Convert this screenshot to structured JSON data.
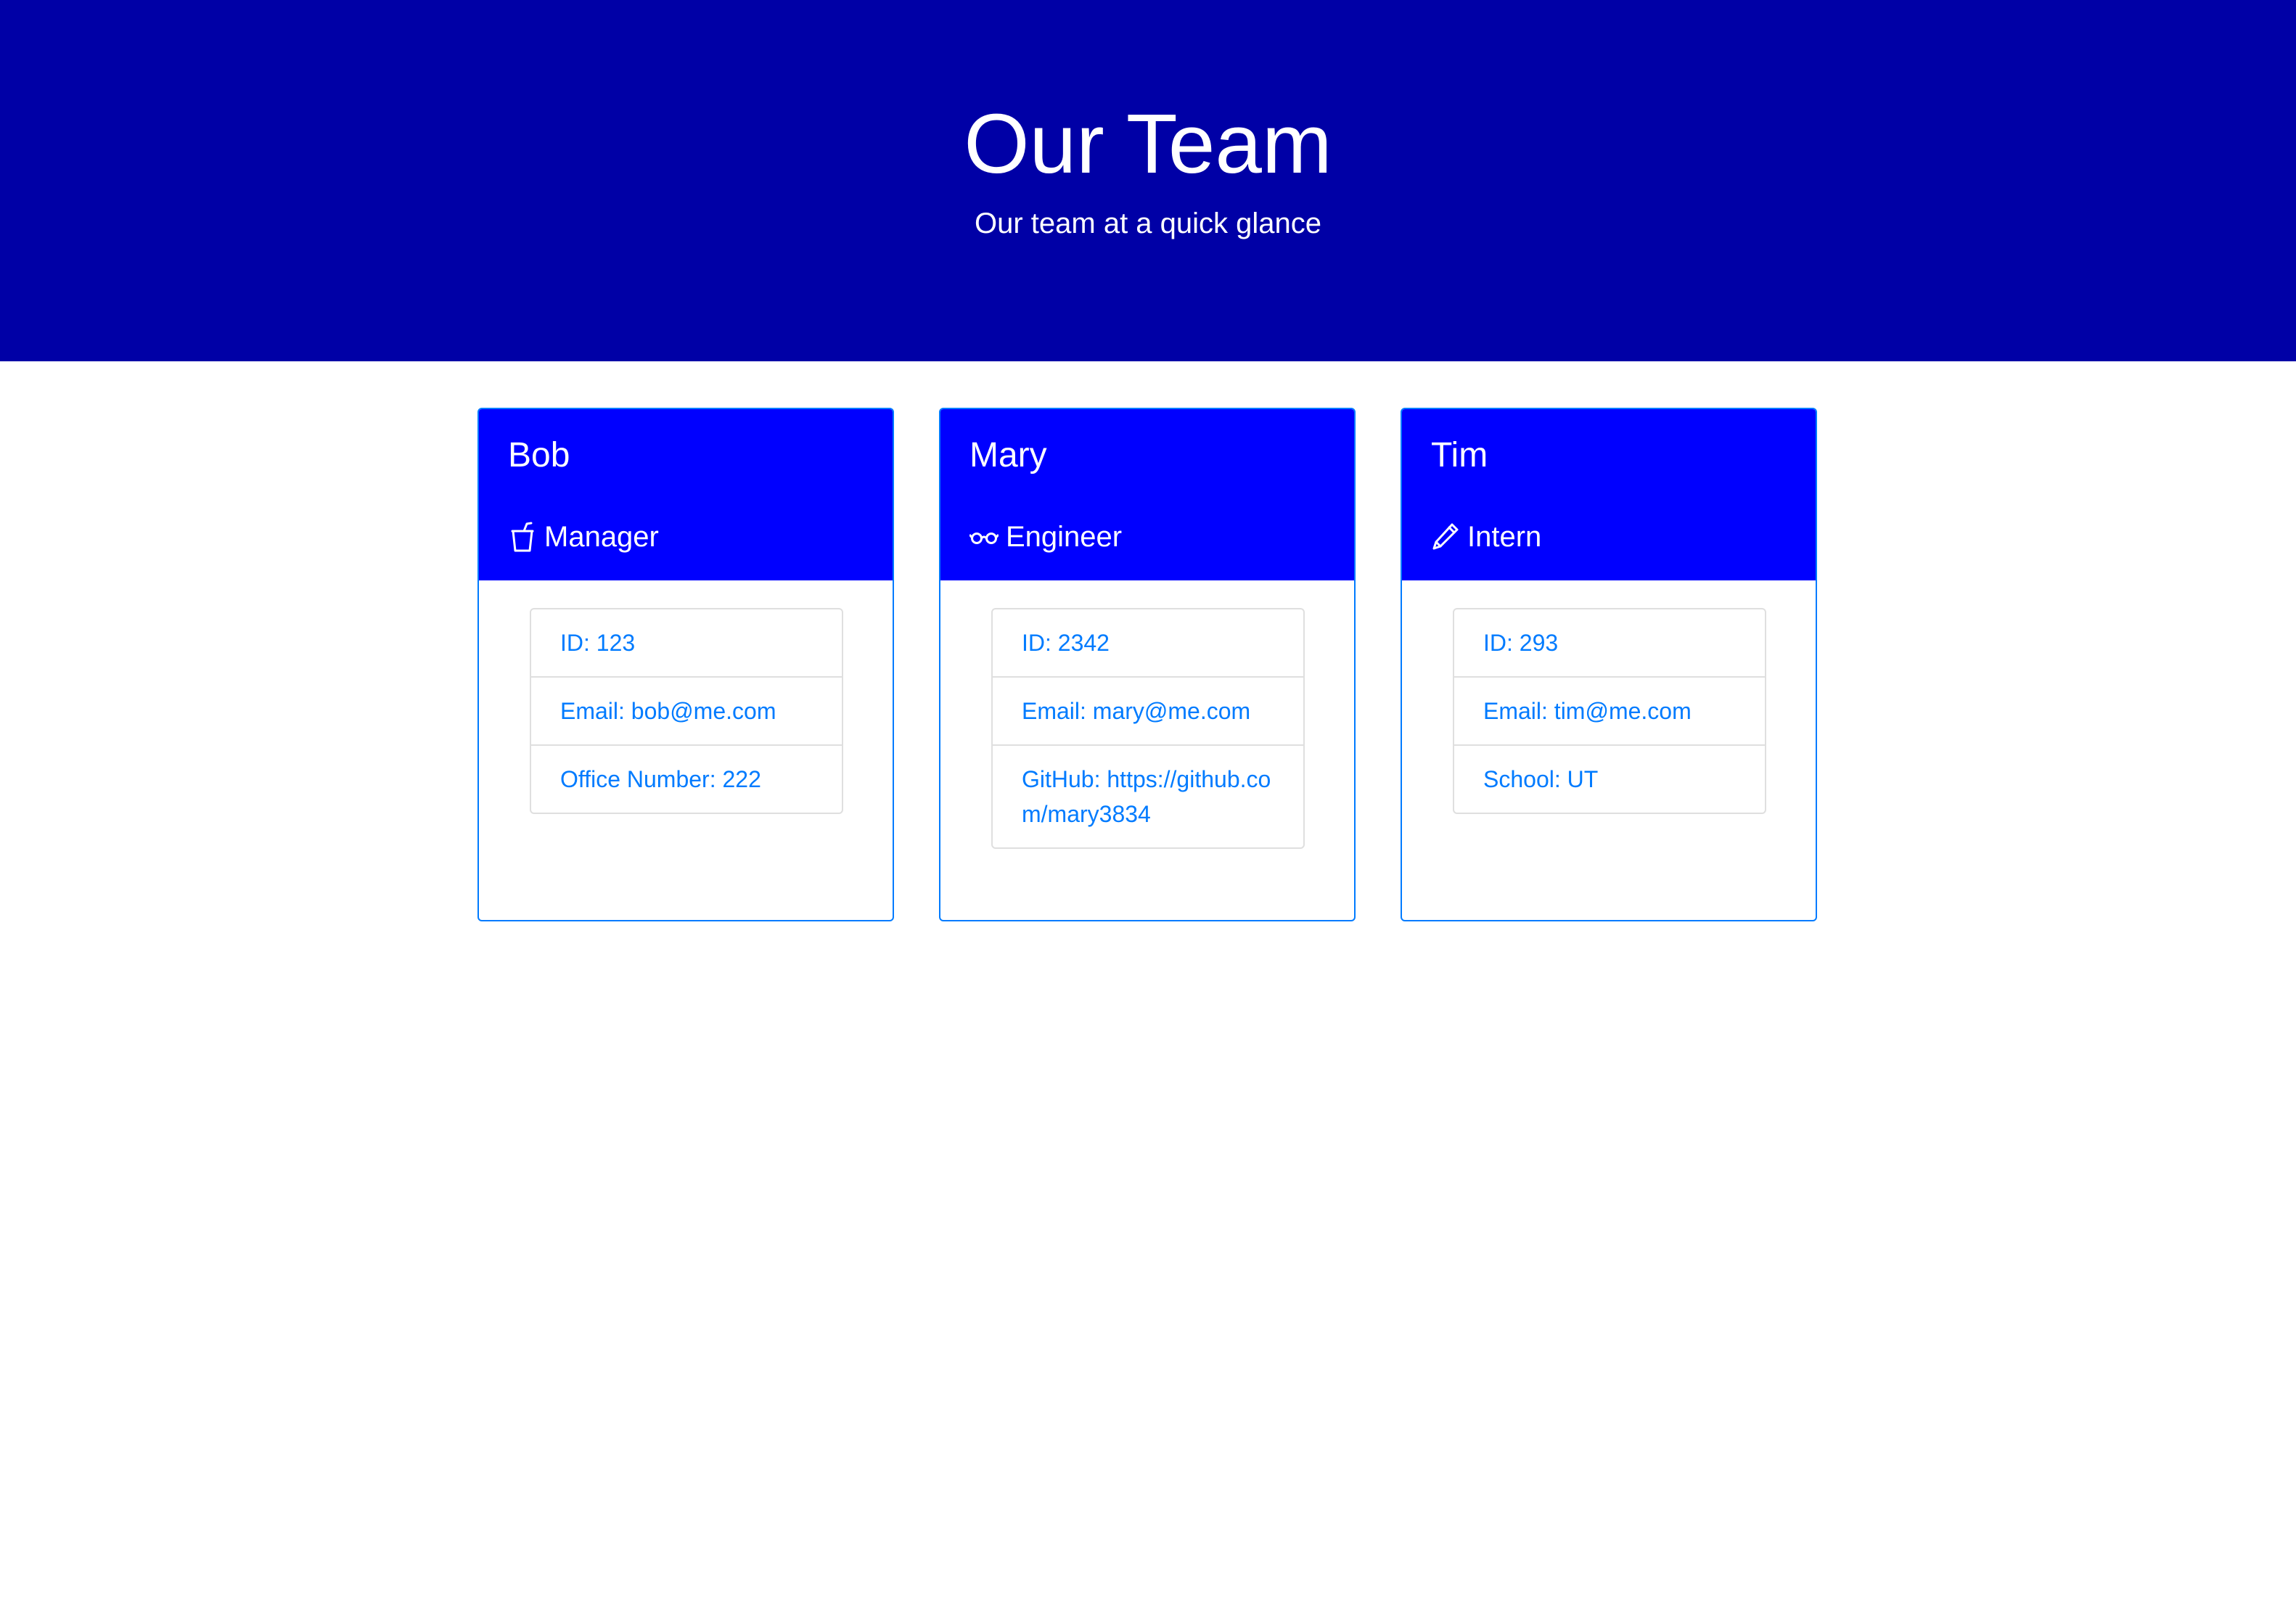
{
  "header": {
    "title": "Our Team",
    "subtitle": "Our team at a quick glance",
    "background_color": "#0000a6"
  },
  "accent_color": "#0000ff",
  "link_color": "#007bff",
  "cards": [
    {
      "name": "Bob",
      "role": "Manager",
      "role_icon": "cup-icon",
      "items": [
        {
          "label": "ID:",
          "value": "123"
        },
        {
          "label": "Email:",
          "value": "bob@me.com"
        },
        {
          "label": "Office Number:",
          "value": "222"
        }
      ]
    },
    {
      "name": "Mary",
      "role": "Engineer",
      "role_icon": "glasses-icon",
      "items": [
        {
          "label": "ID:",
          "value": "2342"
        },
        {
          "label": "Email:",
          "value": "mary@me.com"
        },
        {
          "label": "GitHub:",
          "value": "https://github.com/mary3834"
        }
      ]
    },
    {
      "name": "Tim",
      "role": "Intern",
      "role_icon": "pencil-icon",
      "items": [
        {
          "label": "ID:",
          "value": "293"
        },
        {
          "label": "Email:",
          "value": "tim@me.com"
        },
        {
          "label": "School:",
          "value": "UT"
        }
      ]
    }
  ]
}
